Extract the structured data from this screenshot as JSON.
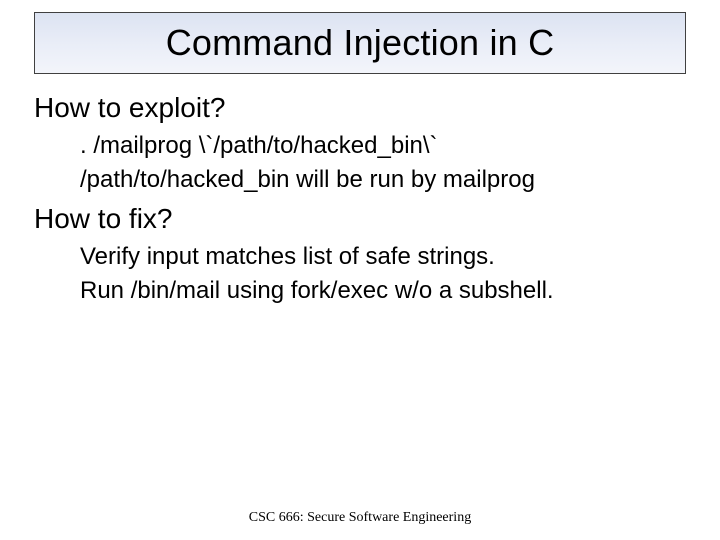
{
  "slide": {
    "title": "Command Injection in C",
    "sections": [
      {
        "heading": "How to exploit?",
        "lines": [
          ". /mailprog \\`/path/to/hacked_bin\\`",
          "/path/to/hacked_bin will be run by mailprog"
        ]
      },
      {
        "heading": "How to fix?",
        "lines": [
          "Verify input matches list of safe strings.",
          "Run /bin/mail using fork/exec w/o a subshell."
        ]
      }
    ],
    "footer": "CSC 666: Secure Software Engineering"
  }
}
